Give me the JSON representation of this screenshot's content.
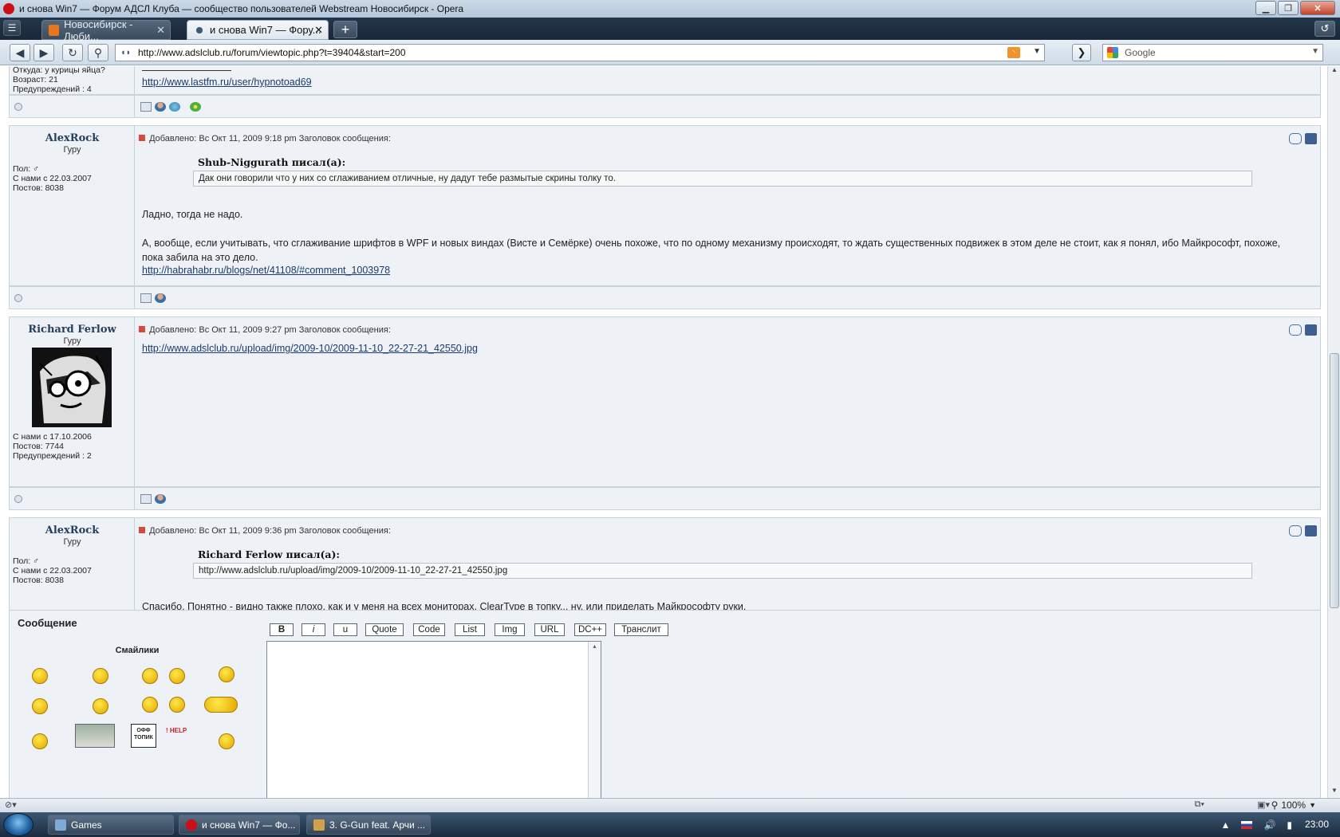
{
  "window": {
    "title": "и снова Win7 — Форум АДСЛ Клуба — сообщество пользователей Webstream Новосибирск - Opera"
  },
  "tabs": [
    {
      "label": "Новосибирск - Люби..."
    },
    {
      "label": "и снова Win7 — Фору..."
    }
  ],
  "address": {
    "url": "http://www.adslclub.ru/forum/viewtopic.php?t=39404&start=200",
    "search_placeholder": "Google"
  },
  "top_partial": {
    "from": "Откуда: у курицы яйца?",
    "age": "Возраст: 21",
    "warnings": "Предупреждений : 4",
    "signature_link": "http://www.lastfm.ru/user/hypnotoad69"
  },
  "posts": [
    {
      "author": "AlexRock",
      "rank": "Гуру",
      "gender": "Пол: ♂",
      "joined": "С нами с 22.03.2007",
      "posts": "Постов: 8038",
      "header": "Добавлено: Вс Окт 11, 2009 9:18 pm    Заголовок сообщения:",
      "quote_author": "Shub-Niggurath писал(а):",
      "quote_text": "Дак они говорили что у них со сглаживанием отличные, ну дадут тебе размытые скрины толку то.",
      "text1": "Ладно, тогда не надо.",
      "text2": "А, вообще, если учитывать, что сглаживание шрифтов в WPF и новых виндах (Висте и Семёрке) очень похоже, что по одному механизму происходят, то ждать существенных подвижек в этом деле не стоит, как я понял, ибо Майкрософт, похоже, пока забила на это дело.",
      "link": "http://habrahabr.ru/blogs/net/41108/#comment_1003978"
    },
    {
      "author": "Richard Ferlow",
      "rank": "Гуру",
      "joined": "С нами с 17.10.2006",
      "posts": "Постов: 7744",
      "warnings": "Предупреждений : 2",
      "header": "Добавлено: Вс Окт 11, 2009 9:27 pm    Заголовок сообщения:",
      "link": "http://www.adslclub.ru/upload/img/2009-10/2009-11-10_22-27-21_42550.jpg"
    },
    {
      "author": "AlexRock",
      "rank": "Гуру",
      "gender": "Пол: ♂",
      "joined": "С нами с 22.03.2007",
      "posts": "Постов: 8038",
      "header": "Добавлено: Вс Окт 11, 2009 9:36 pm    Заголовок сообщения:",
      "quote_author": "Richard Ferlow писал(а):",
      "quote_text": "http://www.adslclub.ru/upload/img/2009-10/2009-11-10_22-27-21_42550.jpg",
      "text1": "Спасибо. Понятно - видно также плохо, как и у меня на всех мониторах. ClearType в топку... ну, или приделать Майкрософту руки."
    }
  ],
  "reply": {
    "label": "Сообщение",
    "smilies_title": "Смайлики",
    "smiley_sign_off": "ОФФ ТОПИК",
    "smiley_sign_help": "! HELP",
    "buttons": [
      "B",
      "i",
      "u",
      "Quote",
      "Code",
      "List",
      "Img",
      "URL",
      "DC++",
      "Транслит"
    ]
  },
  "statusbar": {
    "zoom": "100%"
  },
  "taskbar": {
    "items": [
      "Games",
      "и снова Win7 — Фо...",
      "3. G-Gun feat. Арчи ..."
    ],
    "clock": "23:00"
  },
  "colors": {
    "post_bg": "#eef1f5",
    "border": "#c9d1da",
    "link": "#1b3c6e",
    "author": "#23405d"
  }
}
